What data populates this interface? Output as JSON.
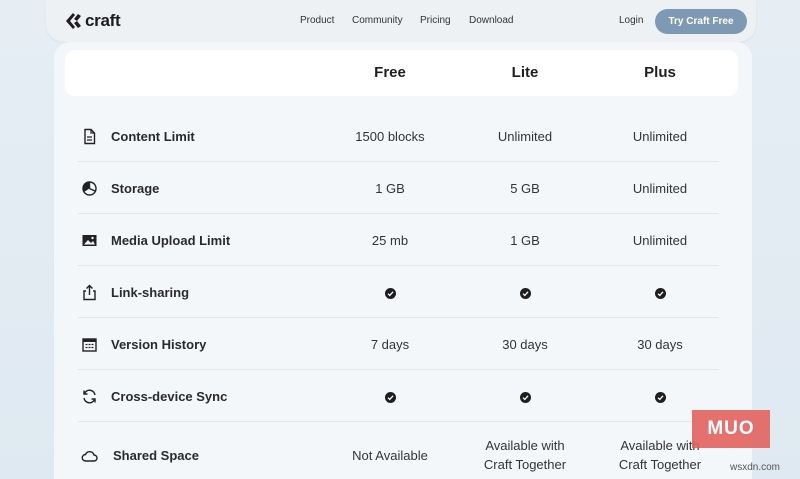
{
  "nav": {
    "logo_text": "craft",
    "links": [
      "Product",
      "Community",
      "Pricing",
      "Download"
    ],
    "login": "Login",
    "cta": "Try Craft Free"
  },
  "plans": [
    "Free",
    "Lite",
    "Plus"
  ],
  "features": [
    {
      "label": "Content Limit",
      "icon": "document-icon",
      "values": [
        "1500 blocks",
        "Unlimited",
        "Unlimited"
      ]
    },
    {
      "label": "Storage",
      "icon": "pie-chart-icon",
      "values": [
        "1 GB",
        "5 GB",
        "Unlimited"
      ]
    },
    {
      "label": "Media Upload Limit",
      "icon": "image-icon",
      "values": [
        "25 mb",
        "1 GB",
        "Unlimited"
      ]
    },
    {
      "label": "Link-sharing",
      "icon": "share-icon",
      "values": [
        true,
        true,
        true
      ]
    },
    {
      "label": "Version History",
      "icon": "calendar-icon",
      "values": [
        "7 days",
        "30 days",
        "30 days"
      ]
    },
    {
      "label": "Cross-device Sync",
      "icon": "sync-icon",
      "values": [
        true,
        true,
        true
      ]
    },
    {
      "label": "Shared Space",
      "icon": "cloud-icon",
      "values": [
        "Not Available",
        "Available with\nCraft Together",
        "Available with\nCraft Together"
      ]
    }
  ],
  "watermark": {
    "logo": "MUO",
    "site": "wsxdn.com"
  },
  "colors": {
    "accent": "#7e99b3",
    "background": "#e6eef4",
    "card": "#f4f7f9"
  }
}
